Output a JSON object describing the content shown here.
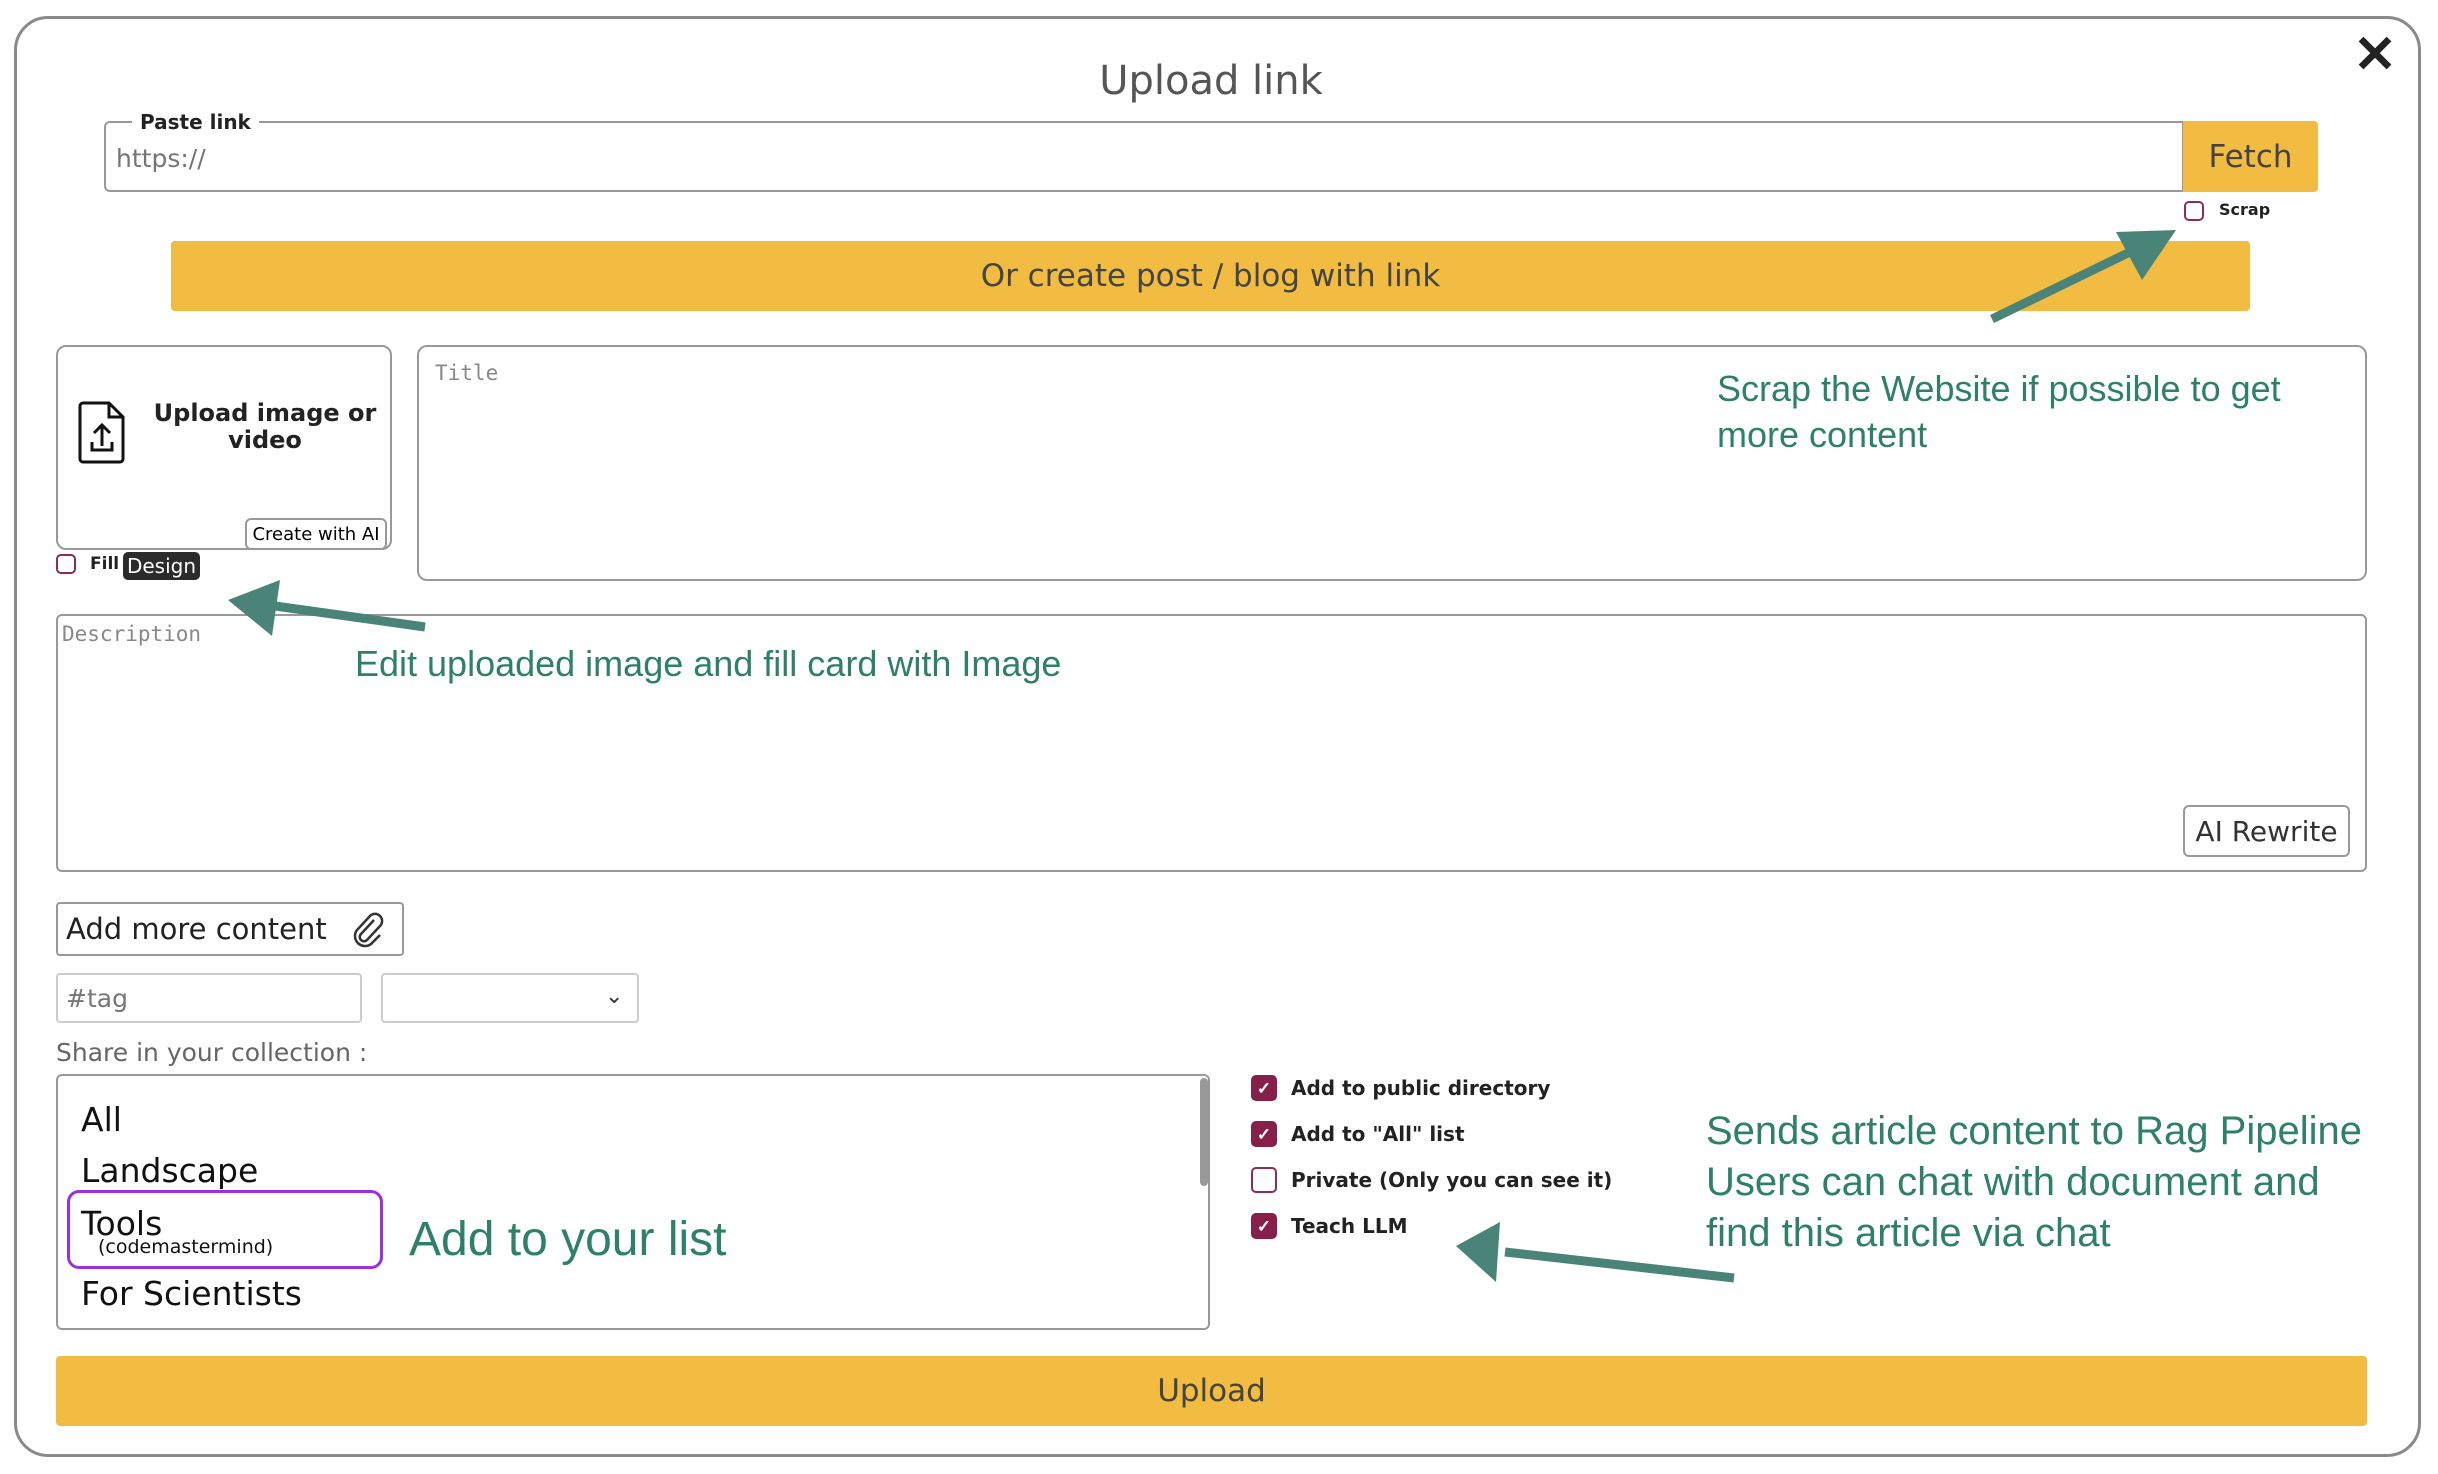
{
  "dialog": {
    "title": "Upload link",
    "close_icon": "close-icon"
  },
  "paste": {
    "legend": "Paste link",
    "placeholder": "https://",
    "fetch_label": "Fetch",
    "scrap_label": "Scrap",
    "scrap_checked": false
  },
  "create_post_label": "Or create post / blog with link",
  "upload_media": {
    "label": "Upload image or video",
    "create_ai_label": "Create with AI",
    "fill_label": "Fill",
    "design_label": "Design",
    "fill_checked": false
  },
  "title_placeholder": "Title",
  "description_placeholder": "Description",
  "ai_rewrite_label": "AI Rewrite",
  "add_more_label": "Add more content",
  "tag_placeholder": "#tag",
  "select_value": "",
  "share_label": "Share in your collection :",
  "collections": [
    {
      "name": "All"
    },
    {
      "name": "Landscape"
    },
    {
      "name": "Tools",
      "owner": "(codemastermind)",
      "highlighted": true
    },
    {
      "name": "For Scientists"
    }
  ],
  "options": [
    {
      "label": "Add to public directory",
      "checked": true
    },
    {
      "label": "Add to \"All\" list",
      "checked": true
    },
    {
      "label": "Private (Only you can see it)",
      "checked": false
    },
    {
      "label": "Teach LLM",
      "checked": true
    }
  ],
  "upload_label": "Upload",
  "annotations": {
    "scrap": [
      "Scrap the Website if possible to get",
      "more content"
    ],
    "edit": "Edit uploaded image and fill card with Image",
    "list": "Add to your list",
    "rag": [
      "Sends article content to Rag Pipeline",
      "Users can chat with document and",
      "find this article via chat"
    ]
  },
  "colors": {
    "accent": "#f2bc42",
    "checkbox": "#861f4a",
    "annotation": "#2e8068",
    "arrow": "#4a8478",
    "highlight": "#9b30e0"
  }
}
